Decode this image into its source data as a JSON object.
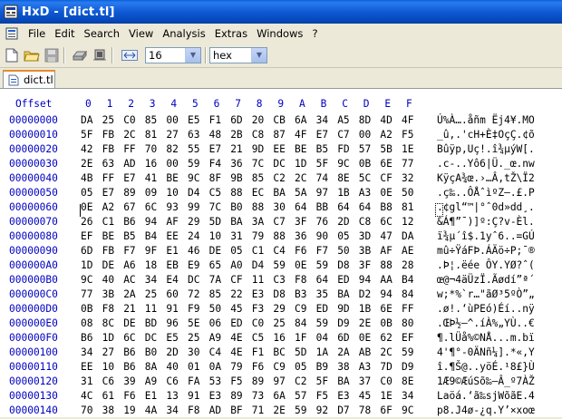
{
  "window": {
    "title": "HxD - [dict.tl]"
  },
  "menu": {
    "items": [
      "File",
      "Edit",
      "Search",
      "View",
      "Analysis",
      "Extras",
      "Windows",
      "?"
    ]
  },
  "toolbar": {
    "columns_value": "16",
    "mode_value": "hex"
  },
  "tab": {
    "label": "dict.tl"
  },
  "editor": {
    "offset_header": "Offset",
    "column_headers": [
      "0",
      "1",
      "2",
      "3",
      "4",
      "5",
      "6",
      "7",
      "8",
      "9",
      "A",
      "B",
      "C",
      "D",
      "E",
      "F"
    ],
    "rows": [
      {
        "offset": "00000000",
        "bytes": [
          "DA",
          "25",
          "C0",
          "85",
          "00",
          "E5",
          "F1",
          "6D",
          "20",
          "CB",
          "6A",
          "34",
          "A5",
          "8D",
          "4D",
          "4F"
        ],
        "ascii": "Ú%À….åñm Ëj4¥.MO"
      },
      {
        "offset": "00000010",
        "bytes": [
          "5F",
          "FB",
          "2C",
          "81",
          "27",
          "63",
          "48",
          "2B",
          "C8",
          "87",
          "4F",
          "E7",
          "C7",
          "00",
          "A2",
          "F5"
        ],
        "ascii": "_û,.'cH+È‡OçÇ.¢õ"
      },
      {
        "offset": "00000020",
        "bytes": [
          "42",
          "FB",
          "FF",
          "70",
          "82",
          "55",
          "E7",
          "21",
          "9D",
          "EE",
          "BE",
          "B5",
          "FD",
          "57",
          "5B",
          "1E"
        ],
        "ascii": "Bûÿp‚Uç!.î¾µýW[."
      },
      {
        "offset": "00000030",
        "bytes": [
          "2E",
          "63",
          "AD",
          "16",
          "00",
          "59",
          "F4",
          "36",
          "7C",
          "DC",
          "1D",
          "5F",
          "9C",
          "0B",
          "6E",
          "77"
        ],
        "ascii": ".c-..Yô6|Ü._œ.nw"
      },
      {
        "offset": "00000040",
        "bytes": [
          "4B",
          "FF",
          "E7",
          "41",
          "BE",
          "9C",
          "8F",
          "9B",
          "85",
          "C2",
          "2C",
          "74",
          "8E",
          "5C",
          "CF",
          "32"
        ],
        "ascii": "KÿçA¾œ.›…Â,tŽ\\Ï2"
      },
      {
        "offset": "00000050",
        "bytes": [
          "05",
          "E7",
          "89",
          "09",
          "10",
          "D4",
          "C5",
          "88",
          "EC",
          "BA",
          "5A",
          "97",
          "1B",
          "A3",
          "0E",
          "50"
        ],
        "ascii": ".ç‰..ÔÅˆìºZ—.£.P"
      },
      {
        "offset": "00000060",
        "bytes": [
          "0E",
          "A2",
          "67",
          "6C",
          "93",
          "99",
          "7C",
          "B0",
          "88",
          "30",
          "64",
          "BB",
          "64",
          "64",
          "B8",
          "81"
        ],
        "ascii": ".¢gl“™|°ˆ0d»dd¸."
      },
      {
        "offset": "00000070",
        "bytes": [
          "26",
          "C1",
          "B6",
          "94",
          "AF",
          "29",
          "5D",
          "BA",
          "3A",
          "C7",
          "3F",
          "76",
          "2D",
          "C8",
          "6C",
          "12"
        ],
        "ascii": "&Á¶”¯)]º:Ç?v-Èl."
      },
      {
        "offset": "00000080",
        "bytes": [
          "EF",
          "BE",
          "B5",
          "B4",
          "EE",
          "24",
          "10",
          "31",
          "79",
          "88",
          "36",
          "90",
          "05",
          "3D",
          "47",
          "DA"
        ],
        "ascii": "ï¾µ´î$.1yˆ6..=GÚ"
      },
      {
        "offset": "00000090",
        "bytes": [
          "6D",
          "FB",
          "F7",
          "9F",
          "E1",
          "46",
          "DE",
          "05",
          "C1",
          "C4",
          "F6",
          "F7",
          "50",
          "3B",
          "AF",
          "AE"
        ],
        "ascii": "mû÷ŸáFÞ.ÁÄö÷P;¯®"
      },
      {
        "offset": "000000A0",
        "bytes": [
          "1D",
          "DE",
          "A6",
          "18",
          "EB",
          "E9",
          "65",
          "A0",
          "D4",
          "59",
          "0E",
          "59",
          "D8",
          "3F",
          "88",
          "28"
        ],
        "ascii": ".Þ¦.ëée ÔY.YØ?ˆ("
      },
      {
        "offset": "000000B0",
        "bytes": [
          "9C",
          "40",
          "AC",
          "34",
          "E4",
          "DC",
          "7A",
          "CF",
          "11",
          "C3",
          "F8",
          "64",
          "ED",
          "94",
          "AA",
          "B4"
        ],
        "ascii": "œ@¬4äÜzÏ.Ãødí”ª´"
      },
      {
        "offset": "000000C0",
        "bytes": [
          "77",
          "3B",
          "2A",
          "25",
          "60",
          "72",
          "85",
          "22",
          "E3",
          "D8",
          "B3",
          "35",
          "BA",
          "D2",
          "94",
          "84"
        ],
        "ascii": "w;*%`r…\"ãØ³5ºÒ”„"
      },
      {
        "offset": "000000D0",
        "bytes": [
          "0B",
          "F8",
          "21",
          "11",
          "91",
          "F9",
          "50",
          "45",
          "F3",
          "29",
          "C9",
          "ED",
          "9D",
          "1B",
          "6E",
          "FF"
        ],
        "ascii": ".ø!.‘ùPEó)Éí..nÿ"
      },
      {
        "offset": "000000E0",
        "bytes": [
          "08",
          "8C",
          "DE",
          "BD",
          "96",
          "5E",
          "06",
          "ED",
          "C0",
          "25",
          "84",
          "59",
          "D9",
          "2E",
          "0B",
          "80"
        ],
        "ascii": ".ŒÞ½–^.íÀ%„YÙ..€"
      },
      {
        "offset": "000000F0",
        "bytes": [
          "B6",
          "1D",
          "6C",
          "DC",
          "E5",
          "25",
          "A9",
          "4E",
          "C5",
          "16",
          "1F",
          "04",
          "6D",
          "0E",
          "62",
          "EF"
        ],
        "ascii": "¶.lÜå%©NÅ...m.bï"
      },
      {
        "offset": "00000100",
        "bytes": [
          "34",
          "27",
          "B6",
          "B0",
          "2D",
          "30",
          "C4",
          "4E",
          "F1",
          "BC",
          "5D",
          "1A",
          "2A",
          "AB",
          "2C",
          "59"
        ],
        "ascii": "4'¶°-0ÄNñ¼].*«,Y"
      },
      {
        "offset": "00000110",
        "bytes": [
          "EE",
          "10",
          "B6",
          "8A",
          "40",
          "01",
          "0A",
          "79",
          "F6",
          "C9",
          "05",
          "B9",
          "38",
          "A3",
          "7D",
          "D9"
        ],
        "ascii": "î.¶Š@..yöÉ.¹8£}Ù"
      },
      {
        "offset": "00000120",
        "bytes": [
          "31",
          "C6",
          "39",
          "A9",
          "C6",
          "FA",
          "53",
          "F5",
          "89",
          "97",
          "C2",
          "5F",
          "BA",
          "37",
          "C0",
          "8E"
        ],
        "ascii": "1Æ9©ÆúSõ‰—Â_º7ÀŽ"
      },
      {
        "offset": "00000130",
        "bytes": [
          "4C",
          "61",
          "F6",
          "E1",
          "13",
          "91",
          "E3",
          "89",
          "73",
          "6A",
          "57",
          "F5",
          "E3",
          "45",
          "1E",
          "34"
        ],
        "ascii": "Laöá.‘ã‰sjWõãE.4"
      },
      {
        "offset": "00000140",
        "bytes": [
          "70",
          "38",
          "19",
          "4A",
          "34",
          "F8",
          "AD",
          "BF",
          "71",
          "2E",
          "59",
          "92",
          "D7",
          "78",
          "6F",
          "9C"
        ],
        "ascii": "p8.J4ø-¿q.Y’×xoœ"
      }
    ]
  },
  "colors": {
    "offset_blue": "#0000c0",
    "titlebar_blue": "#0a5fd8",
    "tab_accent": "#e68b2c"
  }
}
